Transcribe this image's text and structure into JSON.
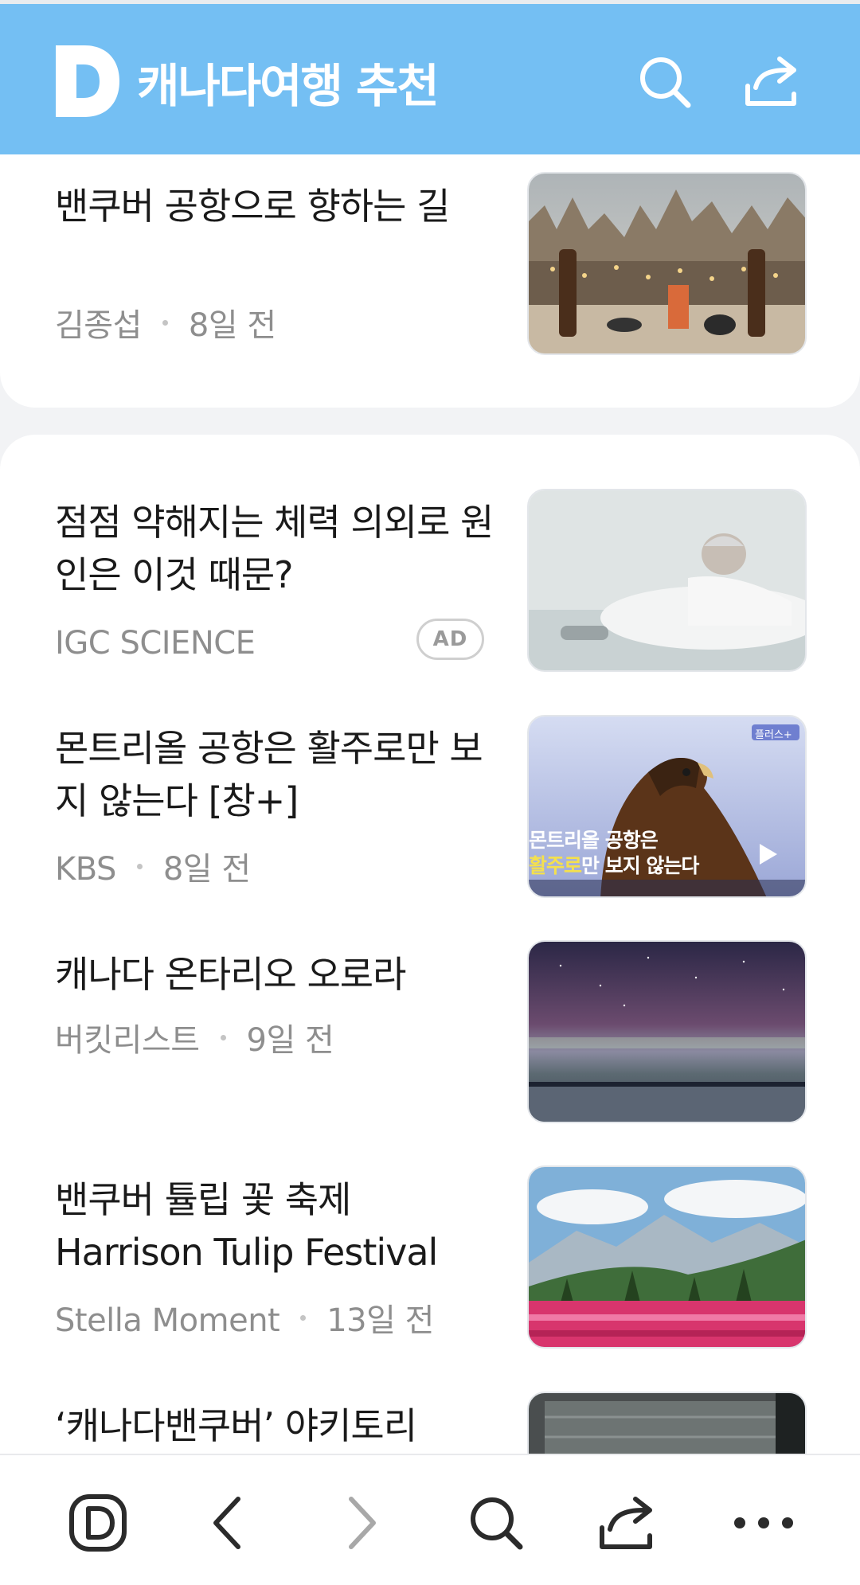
{
  "header": {
    "title": "캐나다여행 추천",
    "background_color": "#74bff3",
    "logo_icon": "daum-d-logo-icon",
    "search_icon": "search-icon",
    "share_icon": "share-icon"
  },
  "articles": [
    {
      "title": "밴쿠버 공항으로 향하는 길",
      "source": "김종섭",
      "time": "8일 전",
      "thumbnail": "cappadocia-terrace-drinks-image"
    },
    {
      "title": "점점 약해지는 체력 의외로 원인은 이것 때문?",
      "source": "IGC SCIENCE",
      "badge": "AD",
      "thumbnail": "elderly-man-sleeping-image"
    },
    {
      "title": "몬트리올 공항은 활주로만 보지 않는다 [창+]",
      "source": "KBS",
      "time": "8일 전",
      "thumbnail": "hawk-video-image",
      "thumb_tag": "플러스+",
      "thumb_caption_line1": "몬트리올 공항은",
      "thumb_caption_highlight": "활주로",
      "thumb_caption_rest": "만 보지 않는다"
    },
    {
      "title": "캐나다 온타리오 오로라",
      "source": "버킷리스트",
      "time": "9일 전",
      "thumbnail": "aurora-night-sky-image"
    },
    {
      "title": "밴쿠버 튤립 꽃 축제 Harrison Tulip Festival",
      "source": "Stella Moment",
      "time": "13일 전",
      "thumbnail": "tulip-field-mountains-image"
    },
    {
      "title": "‘캐나다밴쿠버’ 야키토리",
      "thumbnail": "yakitori-restaurant-image"
    }
  ],
  "bottom_nav": [
    {
      "icon": "daum-home-icon"
    },
    {
      "icon": "back-arrow-icon"
    },
    {
      "icon": "forward-arrow-icon"
    },
    {
      "icon": "search-icon"
    },
    {
      "icon": "share-icon"
    },
    {
      "icon": "more-icon"
    }
  ]
}
